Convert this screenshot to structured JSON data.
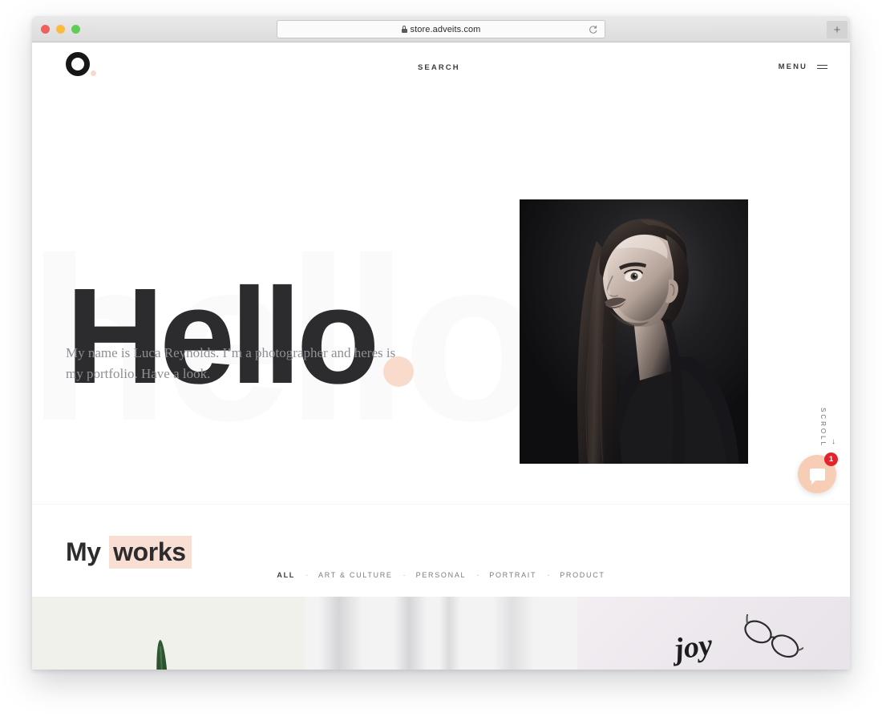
{
  "browser": {
    "url": "store.adveits.com",
    "lock_icon": "lock-icon",
    "reload_icon": "reload-icon",
    "new_tab_label": "+",
    "traffic_lights": [
      "close",
      "minimize",
      "maximize"
    ]
  },
  "header": {
    "logo_icon": "ring-logo-icon",
    "search_label": "SEARCH",
    "menu_label": "MENU",
    "menu_icon": "hamburger-icon"
  },
  "hero": {
    "title": "Hello",
    "watermark": "hello",
    "dot_color": "#f9dbcb",
    "subtitle": "My name is Luca Reynolds. I’m a photographer and heres is my portfolio. Have a look.",
    "photo_alt": "black-and-white-portrait-of-woman-looking-up",
    "scroll_label": "SCROLL",
    "scroll_arrow": "↓"
  },
  "works": {
    "heading_plain": "My",
    "heading_highlight": "works",
    "highlight_color": "#f9dfd3",
    "filters": [
      {
        "label": "ALL",
        "active": true
      },
      {
        "label": "ART & CULTURE",
        "active": false
      },
      {
        "label": "PERSONAL",
        "active": false
      },
      {
        "label": "PORTRAIT",
        "active": false
      },
      {
        "label": "PRODUCT",
        "active": false
      }
    ],
    "filter_separator": "-",
    "gallery": [
      {
        "name": "green-leaf-on-cream-background"
      },
      {
        "name": "white-fabric-curtain-folds"
      },
      {
        "name": "eyeglasses-with-joy-calligraphy"
      }
    ]
  },
  "chat": {
    "icon": "chat-bubble-icon",
    "badge_count": "1",
    "button_color": "#f8cdb6",
    "badge_color": "#e4232c"
  }
}
